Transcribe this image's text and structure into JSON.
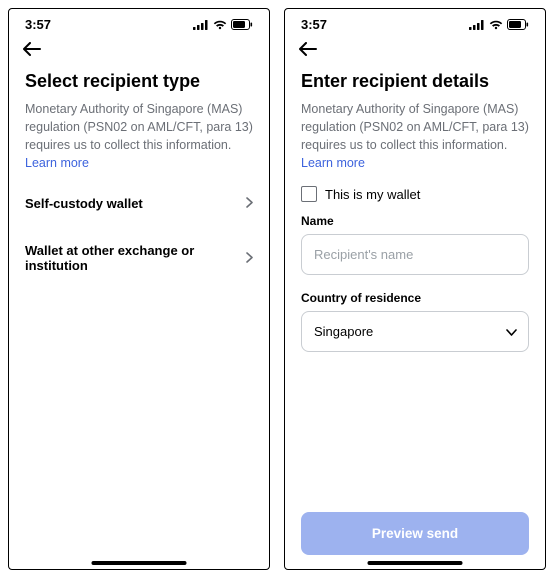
{
  "status": {
    "time": "3:57"
  },
  "colors": {
    "link": "#3d63dd",
    "preview_bg": "#9db2ef"
  },
  "screen1": {
    "title": "Select recipient type",
    "desc": "Monetary Authority of Singapore (MAS) regulation (PSN02 on AML/CFT, para 13) requires us to collect this information.",
    "learn": "Learn more",
    "options": [
      {
        "label": "Self-custody wallet"
      },
      {
        "label": "Wallet at other exchange or institution"
      }
    ]
  },
  "screen2": {
    "title": "Enter recipient details",
    "desc": "Monetary Authority of Singapore (MAS) regulation (PSN02 on AML/CFT, para 13) requires us to collect this information.",
    "learn": "Learn more",
    "checkbox_label": "This is my wallet",
    "name_label": "Name",
    "name_placeholder": "Recipient's name",
    "country_label": "Country of residence",
    "country_value": "Singapore",
    "preview_label": "Preview send"
  }
}
